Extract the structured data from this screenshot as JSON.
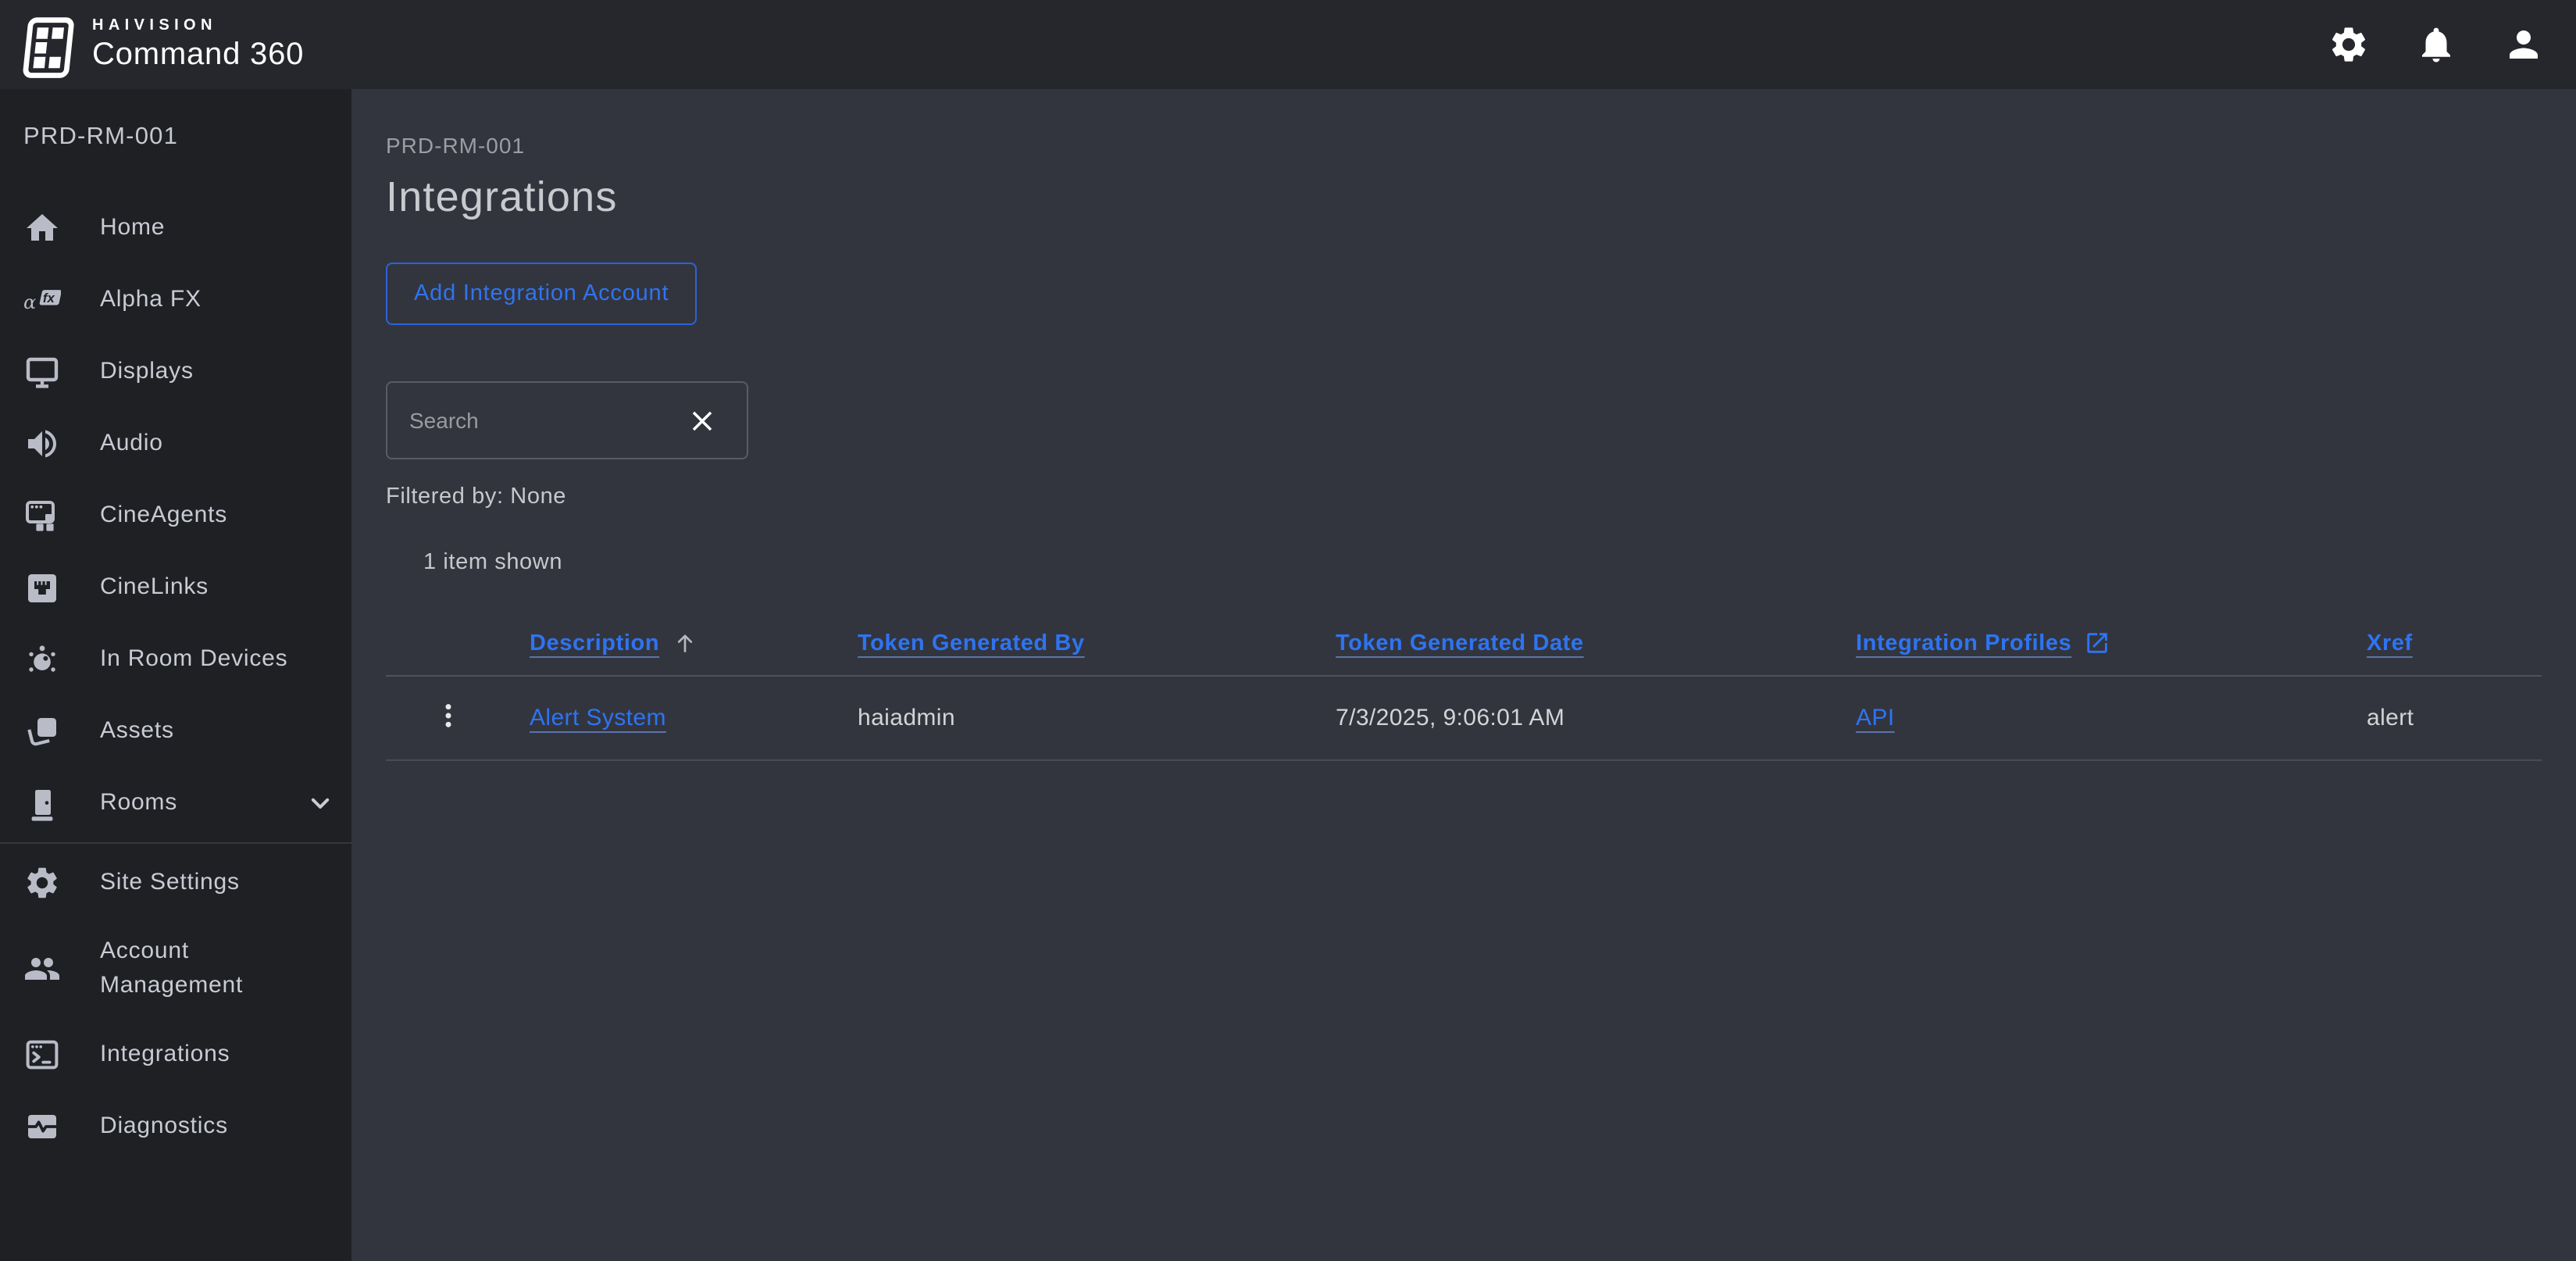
{
  "header": {
    "brand": {
      "line1": "HAIVISION",
      "line2": "Command 360"
    },
    "icons": [
      "settings",
      "notifications",
      "account"
    ]
  },
  "sidebar": {
    "site_label": "PRD-RM-001",
    "items": [
      {
        "label": "Home",
        "icon": "home"
      },
      {
        "label": "Alpha FX",
        "icon": "alpha-fx"
      },
      {
        "label": "Displays",
        "icon": "display"
      },
      {
        "label": "Audio",
        "icon": "audio"
      },
      {
        "label": "CineAgents",
        "icon": "cineagents"
      },
      {
        "label": "CineLinks",
        "icon": "cinelinks"
      },
      {
        "label": "In Room Devices",
        "icon": "in-room-devices"
      },
      {
        "label": "Assets",
        "icon": "assets"
      },
      {
        "label": "Rooms",
        "icon": "rooms",
        "expandable": true
      },
      {
        "label": "Site Settings",
        "icon": "site-settings"
      },
      {
        "label": "Account Management",
        "icon": "account-management"
      },
      {
        "label": "Integrations",
        "icon": "integrations"
      },
      {
        "label": "Diagnostics",
        "icon": "diagnostics"
      }
    ]
  },
  "main": {
    "breadcrumb": "PRD-RM-001",
    "title": "Integrations",
    "add_button_label": "Add Integration Account",
    "search": {
      "placeholder": "Search",
      "value": ""
    },
    "filtered_by": "Filtered by: None",
    "items_shown": "1 item shown",
    "table": {
      "columns": [
        "Description",
        "Token Generated By",
        "Token Generated Date",
        "Integration Profiles",
        "Xref"
      ],
      "sort": {
        "column": "Description",
        "direction": "asc"
      },
      "rows": [
        {
          "description": "Alert System",
          "token_generated_by": "haiadmin",
          "token_generated_date": "7/3/2025, 9:06:01 AM",
          "integration_profiles": "API",
          "xref": "alert"
        }
      ]
    }
  },
  "colors": {
    "accent_blue": "#2e74f2",
    "topbar_bg": "#26272d",
    "sidebar_bg": "#1e2024",
    "main_bg": "#33353e"
  }
}
